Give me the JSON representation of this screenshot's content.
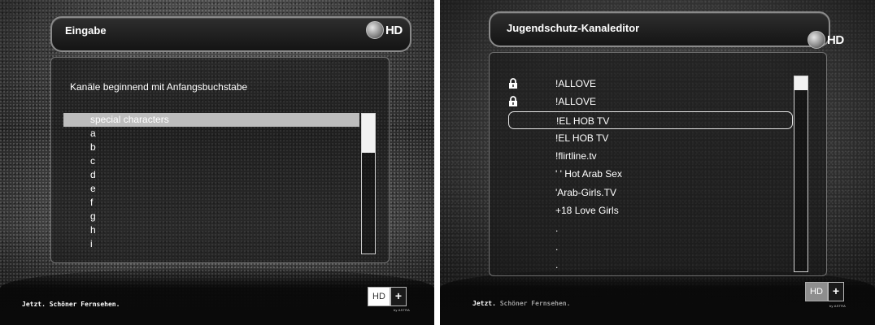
{
  "left_screen": {
    "title": "Eingabe",
    "hd_label": "HD",
    "subtitle": "Kanäle beginnend mit Anfangsbuchstabe",
    "items": [
      "special characters",
      "a",
      "b",
      "c",
      "d",
      "e",
      "f",
      "g",
      "h",
      "i"
    ],
    "selected_index": 0,
    "scroll_position": 0.28,
    "footer_slogan_prefix": "Jetzt.",
    "footer_slogan": "Schöner Fernsehen.",
    "logo_hd": "HD",
    "logo_plus": "+",
    "logo_tag": "by ASTRA"
  },
  "right_screen": {
    "title": "Jugendschutz-Kanaleditor",
    "hd_label": "HD",
    "channels": [
      {
        "name": "!ALLOVE",
        "locked": true
      },
      {
        "name": "!ALLOVE",
        "locked": true
      },
      {
        "name": "!EL HOB TV",
        "locked": false,
        "selected": true
      },
      {
        "name": "!EL HOB TV",
        "locked": false
      },
      {
        "name": "!flirtline.tv",
        "locked": false
      },
      {
        "name": "' ' Hot Arab Sex",
        "locked": false
      },
      {
        "name": "'Arab-Girls.TV",
        "locked": false
      },
      {
        "name": "+18 Love Girls",
        "locked": false
      },
      {
        "name": ".",
        "locked": false
      },
      {
        "name": ".",
        "locked": false
      },
      {
        "name": ".",
        "locked": false
      }
    ],
    "scroll_position": 0.07,
    "footer_slogan_prefix": "Jetzt.",
    "footer_slogan": "Schöner Fernsehen.",
    "logo_hd": "HD",
    "logo_plus": "+",
    "logo_tag": "by ASTRA"
  },
  "icons": {
    "lock": "lock-icon",
    "disc": "hd-disc-icon"
  },
  "colors": {
    "selection_bar": "#bdbdbd",
    "frame_border": "#8a8a8a",
    "text": "#ffffff"
  }
}
